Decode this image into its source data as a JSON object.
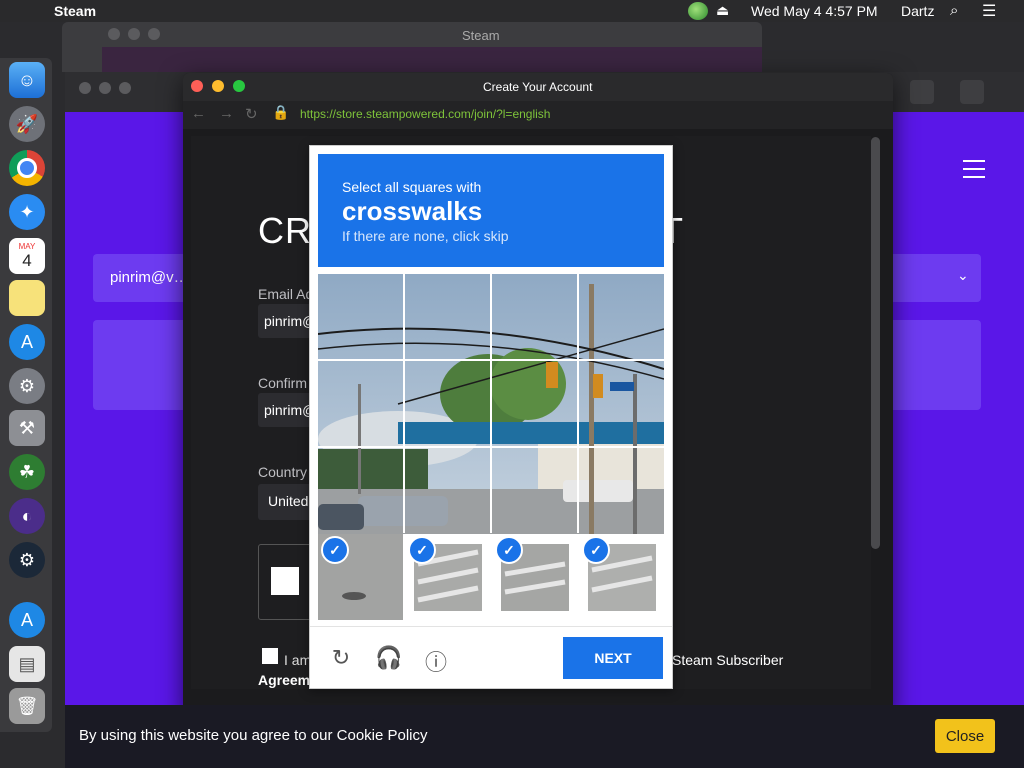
{
  "menubar": {
    "app_name": "Steam",
    "clock": "Wed May 4  4:57 PM",
    "user": "Dartz"
  },
  "bg_window": {
    "title": "Steam"
  },
  "browser": {
    "email_value": "pinrim@v…"
  },
  "dialog": {
    "title": "Create Your Account",
    "url": "https://store.steampowered.com/join/?l=english",
    "page": {
      "heading": "CRE",
      "heading_tail": "T",
      "email_label": "Email Ad",
      "email_value": "pinrim@",
      "confirm_label": "Confirm",
      "confirm_value": "pinrim@",
      "country_label": "Country",
      "country_value": "United",
      "i_am": "I am",
      "agreement": "Agreem",
      "subscriber": "Steam Subscriber"
    }
  },
  "captcha": {
    "line1": "Select all squares with",
    "line2": "crosswalks",
    "line3": "If there are none, click skip",
    "next_label": "NEXT",
    "tiles": [
      {
        "row": 0,
        "col": 0,
        "selected": false
      },
      {
        "row": 0,
        "col": 1,
        "selected": false
      },
      {
        "row": 0,
        "col": 2,
        "selected": false
      },
      {
        "row": 0,
        "col": 3,
        "selected": false
      },
      {
        "row": 1,
        "col": 0,
        "selected": false
      },
      {
        "row": 1,
        "col": 1,
        "selected": false
      },
      {
        "row": 1,
        "col": 2,
        "selected": false
      },
      {
        "row": 1,
        "col": 3,
        "selected": false
      },
      {
        "row": 2,
        "col": 0,
        "selected": false
      },
      {
        "row": 2,
        "col": 1,
        "selected": false
      },
      {
        "row": 2,
        "col": 2,
        "selected": false
      },
      {
        "row": 2,
        "col": 3,
        "selected": false
      },
      {
        "row": 3,
        "col": 0,
        "selected": true
      },
      {
        "row": 3,
        "col": 1,
        "selected": true
      },
      {
        "row": 3,
        "col": 2,
        "selected": true
      },
      {
        "row": 3,
        "col": 3,
        "selected": true
      }
    ]
  },
  "cookie": {
    "text": "By using this website you agree to our Cookie Policy",
    "close_label": "Close"
  },
  "colors": {
    "captcha_blue": "#1a73e8",
    "browser_purple": "#5a17e8",
    "url_green": "#7ec33a",
    "cookie_button": "#f2c21b"
  },
  "dock_icons": [
    "finder-icon",
    "launchpad-icon",
    "chrome-icon",
    "safari-icon",
    "calendar-icon",
    "notes-icon",
    "app-store-icon",
    "system-preferences-icon",
    "automator-icon",
    "clover-icon",
    "browser-icon",
    "steam-icon",
    "app-store-icon-2",
    "file-icon",
    "trash-icon"
  ],
  "calendar": {
    "month": "MAY",
    "day": "4"
  }
}
